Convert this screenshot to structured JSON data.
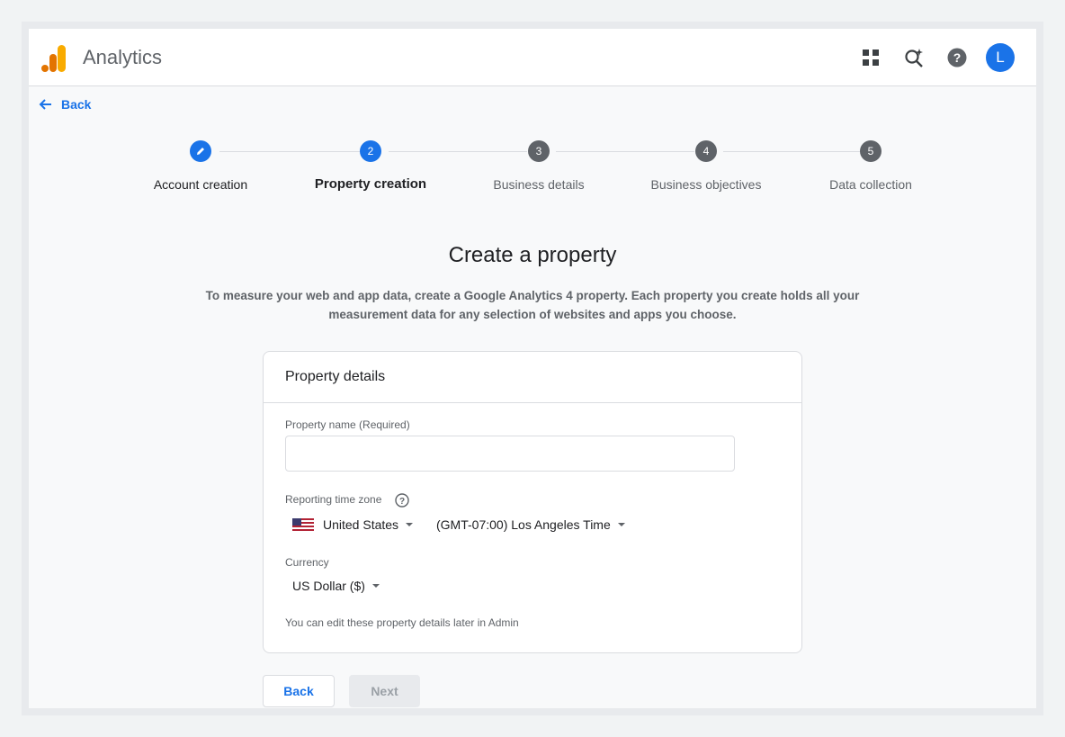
{
  "header": {
    "app_title": "Analytics",
    "icons": [
      "apps-grid-icon",
      "search-insights-icon",
      "help-icon"
    ],
    "avatar_initial": "L"
  },
  "nav": {
    "back_label": "Back"
  },
  "stepper": {
    "steps": [
      {
        "number": "",
        "label": "Account creation",
        "state": "done",
        "icon": "pencil-icon"
      },
      {
        "number": "2",
        "label": "Property creation",
        "state": "active"
      },
      {
        "number": "3",
        "label": "Business details",
        "state": "pending"
      },
      {
        "number": "4",
        "label": "Business objectives",
        "state": "pending"
      },
      {
        "number": "5",
        "label": "Data collection",
        "state": "pending"
      }
    ]
  },
  "main": {
    "title": "Create a property",
    "description_line1": "To measure your web and app data, create a Google Analytics 4 property. Each property you create holds all your",
    "description_line2": "measurement data for any selection of websites and apps you choose."
  },
  "card": {
    "header": "Property details",
    "property_name_label": "Property name (Required)",
    "property_name_value": "",
    "timezone_label": "Reporting time zone",
    "country_value": "United States",
    "timezone_value": "(GMT-07:00) Los Angeles Time",
    "currency_label": "Currency",
    "currency_value": "US Dollar ($)",
    "hint": "You can edit these property details later in Admin"
  },
  "footer": {
    "back_label": "Back",
    "next_label": "Next"
  },
  "colors": {
    "accent": "#1a73e8",
    "step_pending": "#5f6368",
    "logo_orange": "#f9ab00",
    "logo_dark_orange": "#e37400"
  }
}
